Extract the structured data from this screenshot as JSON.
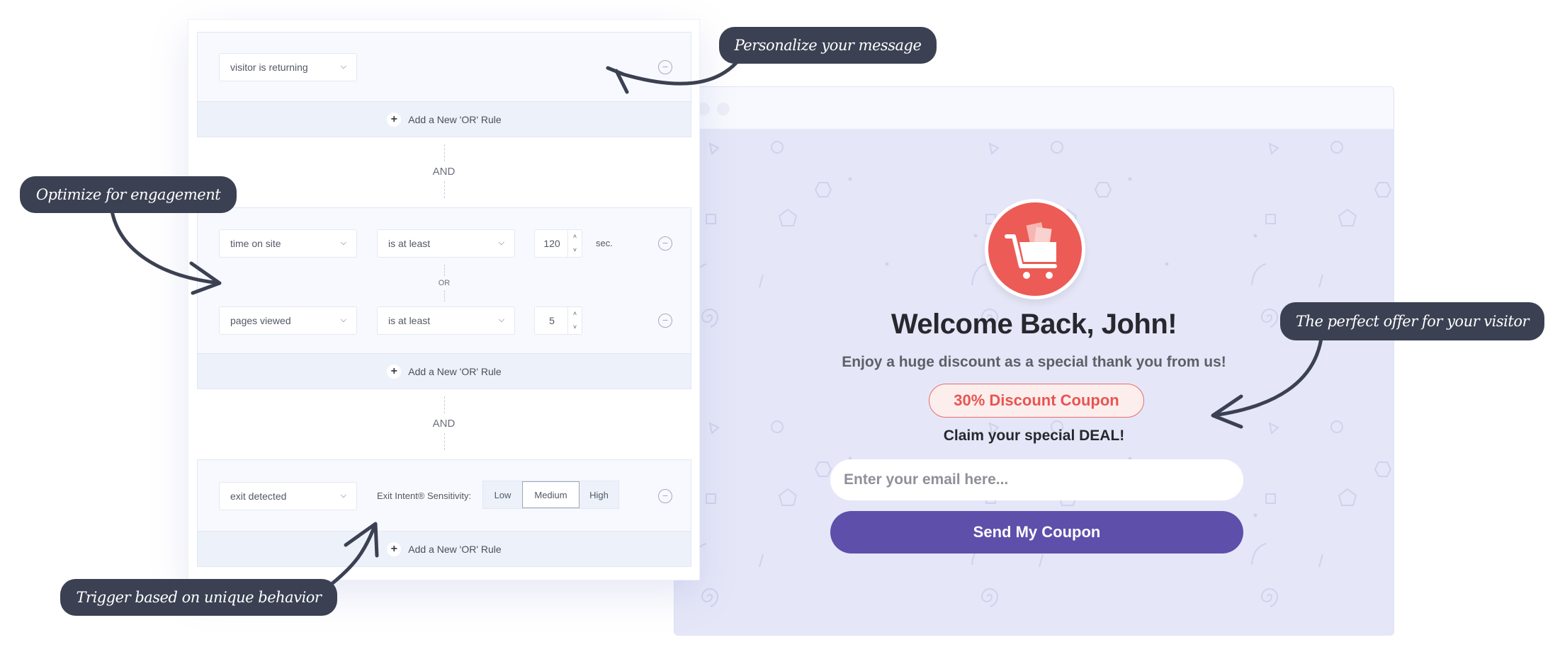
{
  "rules": {
    "add_or_rule_label": "Add a New 'OR' Rule",
    "and_label": "AND",
    "or_label": "OR",
    "block1": {
      "condition": "visitor is returning"
    },
    "block2": {
      "rule1": {
        "condition": "time on site",
        "operator": "is at least",
        "value": "120",
        "unit": "sec."
      },
      "rule2": {
        "condition": "pages viewed",
        "operator": "is at least",
        "value": "5"
      }
    },
    "block3": {
      "condition": "exit detected",
      "sensitivity_label": "Exit Intent® Sensitivity:",
      "sensitivity_options": [
        "Low",
        "Medium",
        "High"
      ],
      "sensitivity_selected": "Medium"
    }
  },
  "callouts": {
    "personalize": "Personalize your message",
    "optimize": "Optimize for engagement",
    "trigger": "Trigger based on unique behavior",
    "offer": "The perfect offer for your visitor"
  },
  "popup": {
    "icon": "shopping-cart-icon",
    "title": "Welcome Back, John!",
    "subtitle": "Enjoy a huge discount as a special thank you from us!",
    "coupon": "30% Discount Coupon",
    "claim": "Claim your special DEAL!",
    "email_placeholder": "Enter your email here...",
    "email_value": "",
    "submit_label": "Send My Coupon"
  },
  "colors": {
    "accent_purple": "#5e4fab",
    "coupon_red": "#ec5b55",
    "callout_dark": "#3b4152",
    "popup_bg": "#e5e7f8"
  }
}
